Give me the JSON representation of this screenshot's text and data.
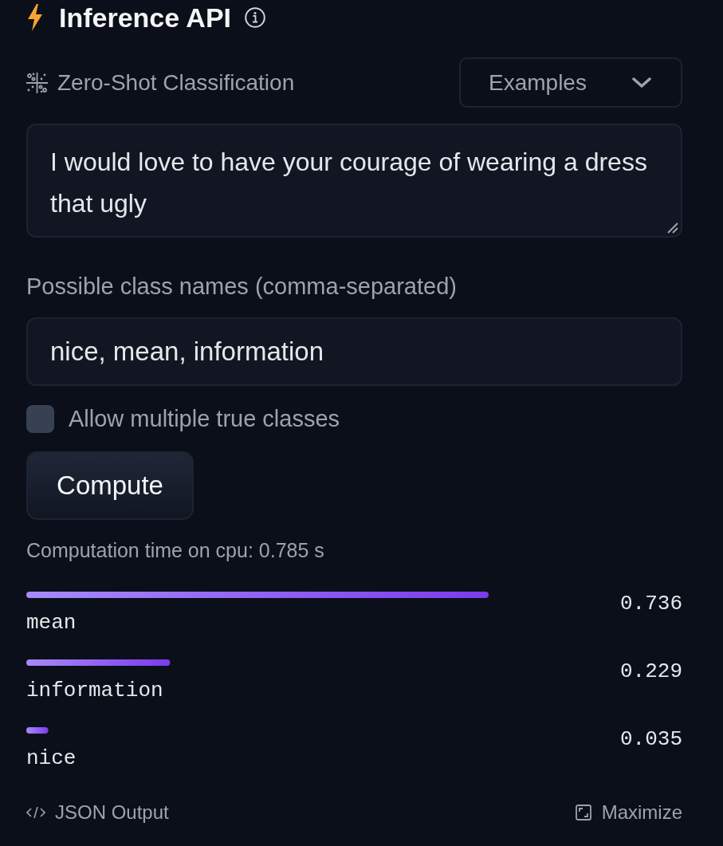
{
  "header": {
    "title": "Inference API"
  },
  "task": {
    "label": "Zero-Shot Classification"
  },
  "examples_dropdown": {
    "label": "Examples"
  },
  "text_input": {
    "value": "I would love to have your courage of wearing a dress that ugly"
  },
  "class_names": {
    "label": "Possible class names (comma-separated)",
    "value": "nice, mean, information"
  },
  "multi_label": {
    "label": "Allow multiple true classes",
    "checked": false
  },
  "compute_button": {
    "label": "Compute"
  },
  "computation_time": "Computation time on cpu: 0.785 s",
  "results": {
    "chart_data": {
      "type": "bar",
      "orientation": "horizontal",
      "categories": [
        "mean",
        "information",
        "nice"
      ],
      "values": [
        0.736,
        0.229,
        0.035
      ],
      "value_labels": [
        "0.736",
        "0.229",
        "0.035"
      ]
    }
  },
  "footer": {
    "json_output": "JSON Output",
    "maximize": "Maximize"
  }
}
